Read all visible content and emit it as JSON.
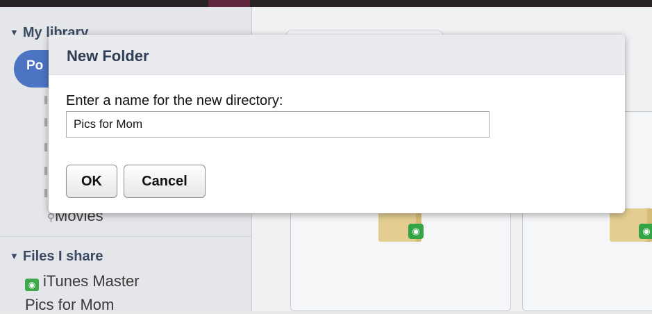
{
  "sidebar": {
    "library_header": "My library",
    "library_user": "Po",
    "movies_item": "Movies",
    "share_header": "Files I share",
    "share_items": [
      "iTunes Master",
      "Pics for Mom"
    ]
  },
  "dialog": {
    "title": "New Folder",
    "prompt": "Enter a name for the new directory:",
    "input_value": "Pics for Mom",
    "ok_label": "OK",
    "cancel_label": "Cancel"
  },
  "icons": {
    "section_toggle": "triangle-down",
    "share": "share-badge",
    "folder": "folder"
  },
  "colors": {
    "accent": "#4c74c2",
    "share_green": "#3ea84a",
    "dialog_header": "#e9ebef"
  }
}
